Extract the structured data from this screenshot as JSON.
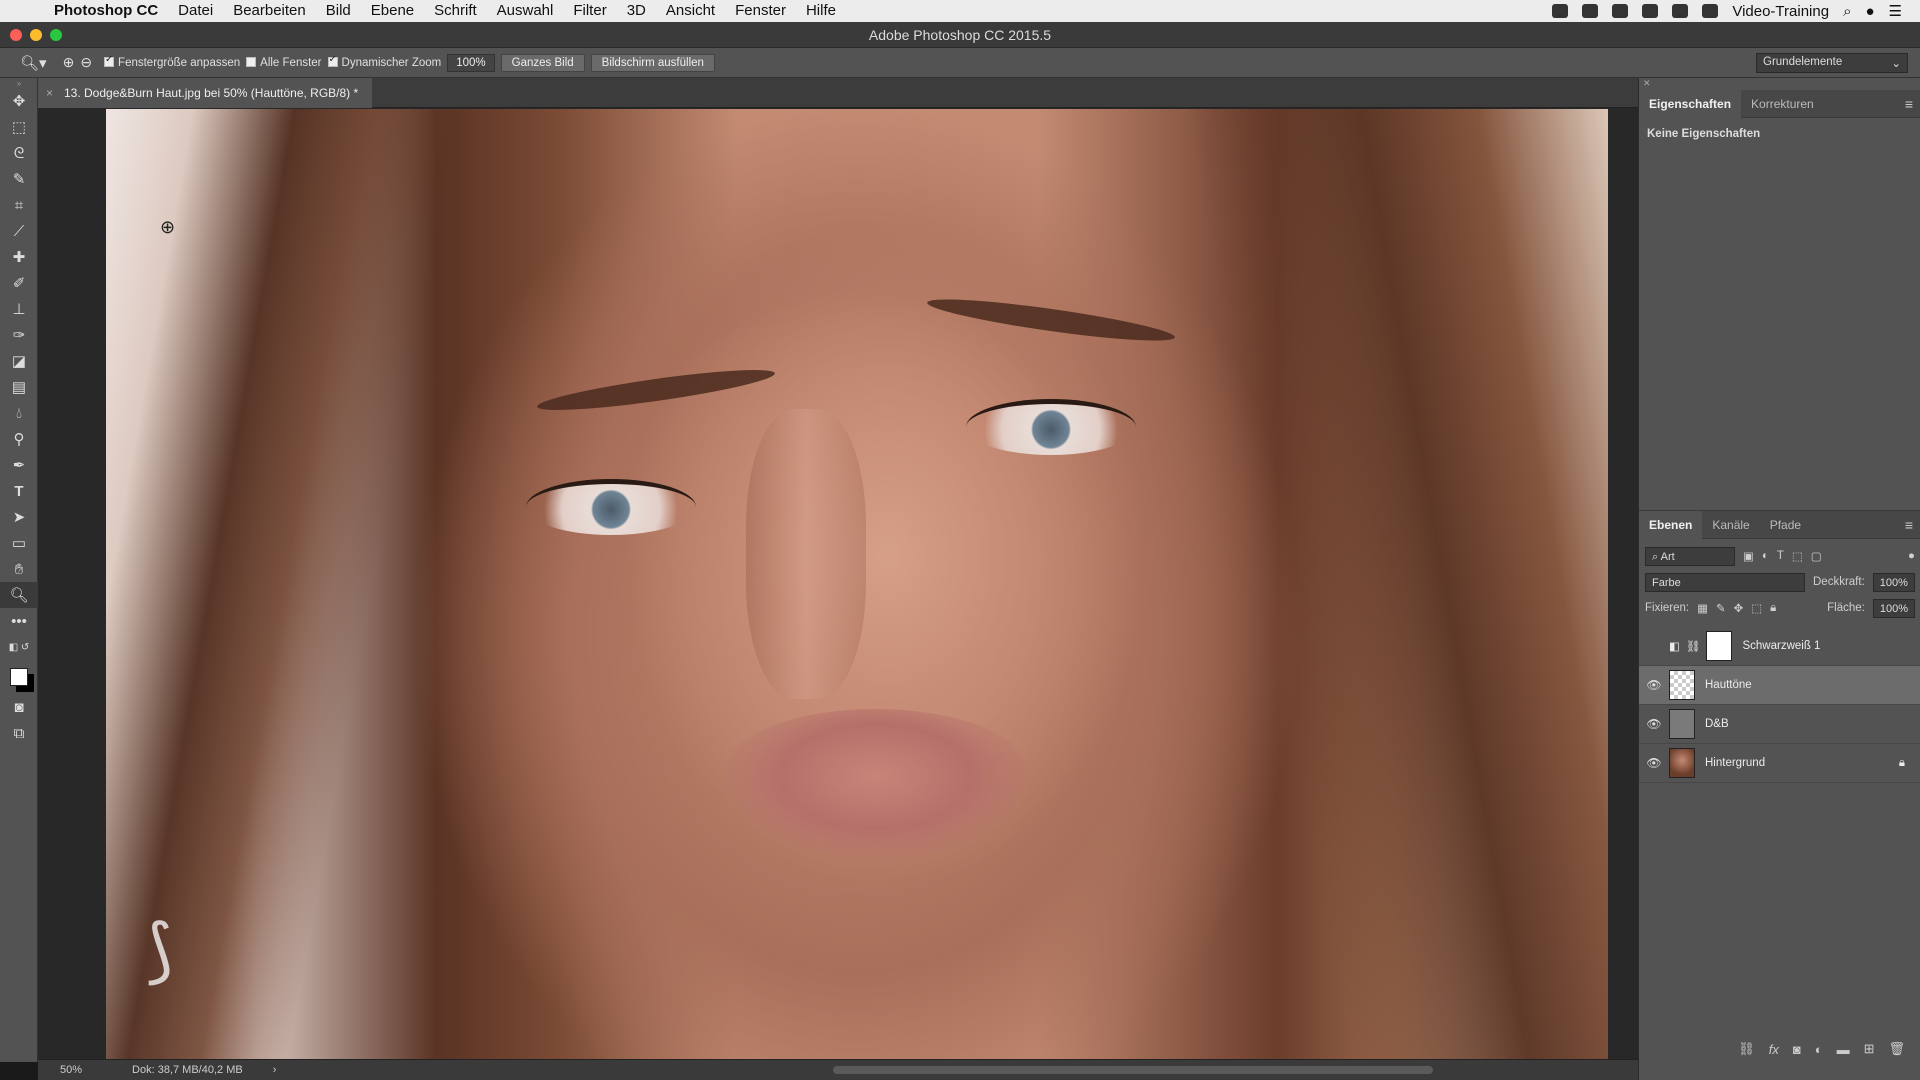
{
  "menubar": {
    "app": "Photoshop CC",
    "items": [
      "Datei",
      "Bearbeiten",
      "Bild",
      "Ebene",
      "Schrift",
      "Auswahl",
      "Filter",
      "3D",
      "Ansicht",
      "Fenster",
      "Hilfe"
    ],
    "user": "Video-Training"
  },
  "window": {
    "title": "Adobe Photoshop CC 2015.5"
  },
  "options": {
    "fit_window": "Fenstergröße anpassen",
    "all_windows": "Alle Fenster",
    "dynamic_zoom": "Dynamischer Zoom",
    "zoom_value": "100%",
    "btn_fit": "Ganzes Bild",
    "btn_fill": "Bildschirm ausfüllen",
    "workspace": "Grundelemente"
  },
  "document": {
    "tab_title": "13. Dodge&Burn Haut.jpg bei 50% (Hauttöne, RGB/8) *"
  },
  "status": {
    "zoom": "50%",
    "doc_size": "Dok: 38,7 MB/40,2 MB"
  },
  "properties": {
    "tabs": [
      "Eigenschaften",
      "Korrekturen"
    ],
    "empty_text": "Keine Eigenschaften"
  },
  "layers_panel": {
    "tabs": [
      "Ebenen",
      "Kanäle",
      "Pfade"
    ],
    "filter_kind": "Art",
    "blend_mode": "Farbe",
    "opacity_label": "Deckkraft:",
    "opacity_value": "100%",
    "lock_label": "Fixieren:",
    "fill_label": "Fläche:",
    "fill_value": "100%",
    "layers": [
      {
        "name": "Schwarzweiß 1",
        "visible": false
      },
      {
        "name": "Hauttöne",
        "visible": true
      },
      {
        "name": "D&B",
        "visible": true
      },
      {
        "name": "Hintergrund",
        "visible": true
      }
    ]
  },
  "icons": {
    "eye": "eye-icon",
    "lock": "lock-icon",
    "zoom": "zoom-tool-icon"
  }
}
